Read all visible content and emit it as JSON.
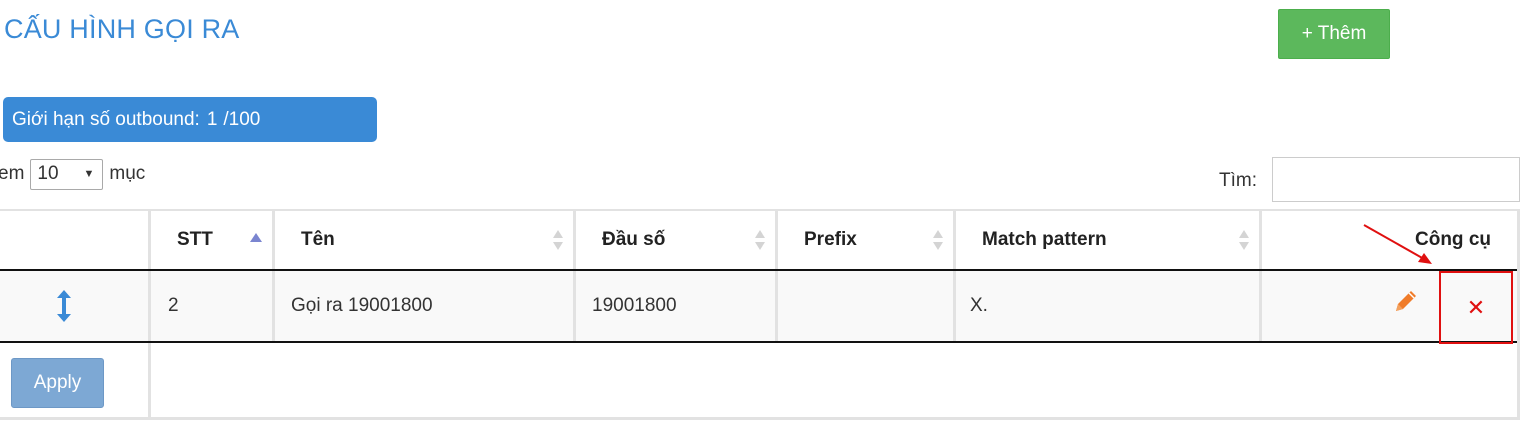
{
  "header": {
    "title": "CẤU HÌNH GỌI RA",
    "add_button_label": "+ Thêm"
  },
  "limit": {
    "label": "Giới hạn số outbound:",
    "current": "1",
    "max": "/100"
  },
  "length_control": {
    "prefix": "em",
    "selected": "10",
    "suffix": "mục"
  },
  "search": {
    "label": "Tìm:",
    "value": ""
  },
  "table": {
    "columns": [
      {
        "label": ""
      },
      {
        "label": "STT",
        "sort": "asc"
      },
      {
        "label": "Tên",
        "sort": "none"
      },
      {
        "label": "Đầu số",
        "sort": "none"
      },
      {
        "label": "Prefix",
        "sort": "none"
      },
      {
        "label": "Match pattern",
        "sort": "none"
      },
      {
        "label": "Công cụ"
      }
    ],
    "rows": [
      {
        "stt": "2",
        "ten": "Gọi ra 19001800",
        "dau_so": "19001800",
        "prefix": "",
        "match_pattern": "X."
      }
    ]
  },
  "footer": {
    "apply_label": "Apply"
  },
  "icons": {
    "drag": "vertical-resize-arrow",
    "edit": "pencil-icon",
    "delete": "close-x-icon"
  },
  "colors": {
    "title": "#3a8ad6",
    "add_button": "#5cb85c",
    "limit_badge": "#3a8ad6",
    "apply_button": "#7da8d4",
    "edit_icon": "#f07c2a",
    "delete_icon": "#e01010",
    "drag_icon": "#3a8ad6",
    "sort_active": "#7a85d0"
  }
}
